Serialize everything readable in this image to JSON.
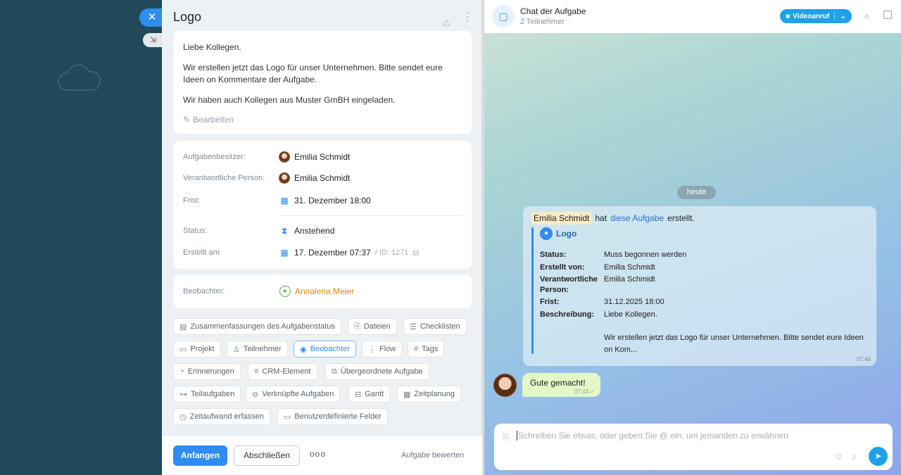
{
  "left": {
    "close_glyph": "✕",
    "minimize_glyph": "⇲"
  },
  "task": {
    "title": "Logo",
    "description": [
      "Liebe Kollegen.",
      "Wir erstellen jetzt das Logo für unser Unternehmen. Bitte sendet eure Ideen on Kommentare der Aufgabe.",
      "Wir haben auch Kollegen aus Muster GmBH eingeladen."
    ],
    "edit_label": "Bearbeiten",
    "details": {
      "owner_label": "Aufgabenbesitzer:",
      "owner_value": "Emilia Schmidt",
      "responsible_label": "Verantwortliche Person:",
      "responsible_value": "Emilia Schmidt",
      "deadline_label": "Frist:",
      "deadline_value": "31. Dezember 18:00",
      "status_label": "Status:",
      "status_value": "Anstehend",
      "created_label": "Erstellt am",
      "created_value": "17. Dezember 07:37",
      "id_value": "/ ID: 1271"
    },
    "observer_label": "Beobachter:",
    "observer_value": "Annalena Meier",
    "chips": [
      {
        "label": "Zusammenfassungen des Aufgabenstatus",
        "icon": "summary-icon"
      },
      {
        "label": "Dateien",
        "icon": "paperclip-icon"
      },
      {
        "label": "Checklisten",
        "icon": "checklist-icon"
      },
      {
        "label": "Projekt",
        "icon": "folder-icon"
      },
      {
        "label": "Teilnehmer",
        "icon": "person-icon"
      },
      {
        "label": "Beobachter",
        "icon": "eye-icon"
      },
      {
        "label": "Flow",
        "icon": "flow-icon"
      },
      {
        "label": "Tags",
        "icon": "hash-icon"
      },
      {
        "label": "Erinnerungen",
        "icon": "bell-icon"
      },
      {
        "label": "CRM-Element",
        "icon": "crm-icon"
      },
      {
        "label": "Übergeordnete Aufgabe",
        "icon": "parent-task-icon"
      },
      {
        "label": "Teilaufgaben",
        "icon": "subtask-icon"
      },
      {
        "label": "Verknüpfte Aufgaben",
        "icon": "link-icon"
      },
      {
        "label": "Gantt",
        "icon": "gantt-icon"
      },
      {
        "label": "Zeitplanung",
        "icon": "calendar-icon"
      },
      {
        "label": "Zeitaufwand erfassen",
        "icon": "stopwatch-icon"
      },
      {
        "label": "Benutzerdefinierte Felder",
        "icon": "custom-fields-icon"
      }
    ],
    "footer": {
      "start": "Anfangen",
      "finish": "Abschließen",
      "more": "ooo",
      "rate": "Aufgabe bewerten"
    }
  },
  "chat": {
    "title": "Chat der Aufgabe",
    "subtitle": "2 Teilnehmer",
    "video_label": "Videoanruf",
    "date_pill": "heute",
    "system": {
      "author": "Emilia Schmidt",
      "verb": "hat",
      "link": "diese Aufgabe",
      "suffix": "erstellt.",
      "quote_title": "Logo",
      "rows": [
        {
          "label": "Status:",
          "value": "Muss begonnen werden"
        },
        {
          "label": "Erstellt von:",
          "value": "Emilia Schmidt"
        },
        {
          "label": "Verantwortliche Person:",
          "value": "Emilia Schmidt"
        },
        {
          "label": "Frist:",
          "value": "31.12.2025 18:00"
        },
        {
          "label": "Beschreibung:",
          "value": "Liebe Kollegen."
        },
        {
          "label": "",
          "value": "Wir erstellen jetzt das Logo für unser Unternehmen. Bitte sendet eure Ideen on Kom..."
        }
      ],
      "time": "07:40"
    },
    "message": {
      "text": "Gute gemacht!",
      "time": "07:43 ✓"
    },
    "composer_placeholder": "Schreiben Sie etwas, oder geben Sie @ ein, um jemanden zu erwähnen"
  },
  "colors": {
    "accent": "#2f8cf0",
    "observer": "#e38a00",
    "bubble": "#e3f7c8"
  }
}
